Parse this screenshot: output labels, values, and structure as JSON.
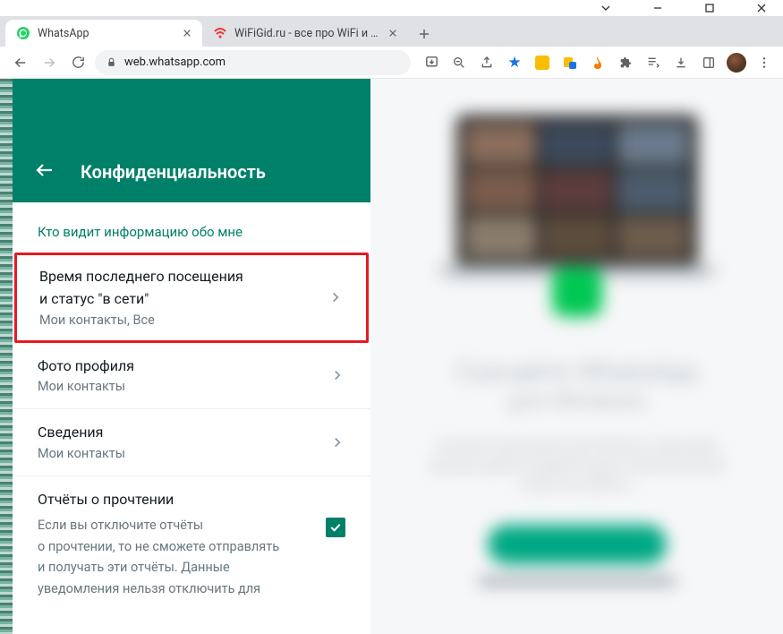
{
  "window_controls": {
    "chevron": "v",
    "min": "−",
    "max": "□",
    "close": "×"
  },
  "tabs": [
    {
      "title": "WhatsApp",
      "active": true,
      "favicon": "whatsapp"
    },
    {
      "title": "WiFiGid.ru - все про WiFi и беспроводные сети",
      "active": false,
      "favicon": "wifigid"
    }
  ],
  "address": {
    "url": "web.whatsapp.com"
  },
  "panel": {
    "title": "Конфиденциальность",
    "section_heading": "Кто видит информацию обо мне",
    "rows": [
      {
        "label_line1": "Время последнего посещения",
        "label_line2": "и статус \"в сети\"",
        "sub": "Мои контакты, Все",
        "highlight": true
      },
      {
        "label": "Фото профиля",
        "sub": "Мои контакты"
      },
      {
        "label": "Сведения",
        "sub": "Мои контакты"
      }
    ],
    "read_receipts": {
      "label": "Отчёты о прочтении",
      "desc_line1": "Если вы отключите отчёты",
      "desc_line2": "о прочтении, то не сможете отправлять",
      "desc_line3": "и получать эти отчёты. Данные",
      "desc_line4": "уведомления нельзя отключить для",
      "checked": true
    }
  },
  "promo": {
    "heading": "Скачайте WhatsApp",
    "sub": "для Windows"
  }
}
